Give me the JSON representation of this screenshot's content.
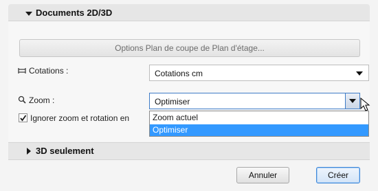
{
  "sections": {
    "top": {
      "title": "Documents 2D/3D",
      "expanded": true
    },
    "bottom": {
      "title": "3D seulement",
      "expanded": false
    }
  },
  "options_button": {
    "label": "Options Plan de coupe de Plan d'étage..."
  },
  "dimensions": {
    "label": "Cotations :",
    "icon": "dimension-icon",
    "value": "Cotations cm"
  },
  "zoom": {
    "label": "Zoom :",
    "icon": "magnifier-icon",
    "value": "Optimiser",
    "options": [
      "Zoom actuel",
      "Optimiser"
    ],
    "selected_index": 1
  },
  "ignore_zoom": {
    "label": "Ignorer zoom et rotation en",
    "checked": true
  },
  "footer": {
    "cancel_label": "Annuler",
    "create_label": "Créer"
  },
  "colors": {
    "highlight": "#3399ff",
    "focus_border": "#3d7bc6"
  }
}
